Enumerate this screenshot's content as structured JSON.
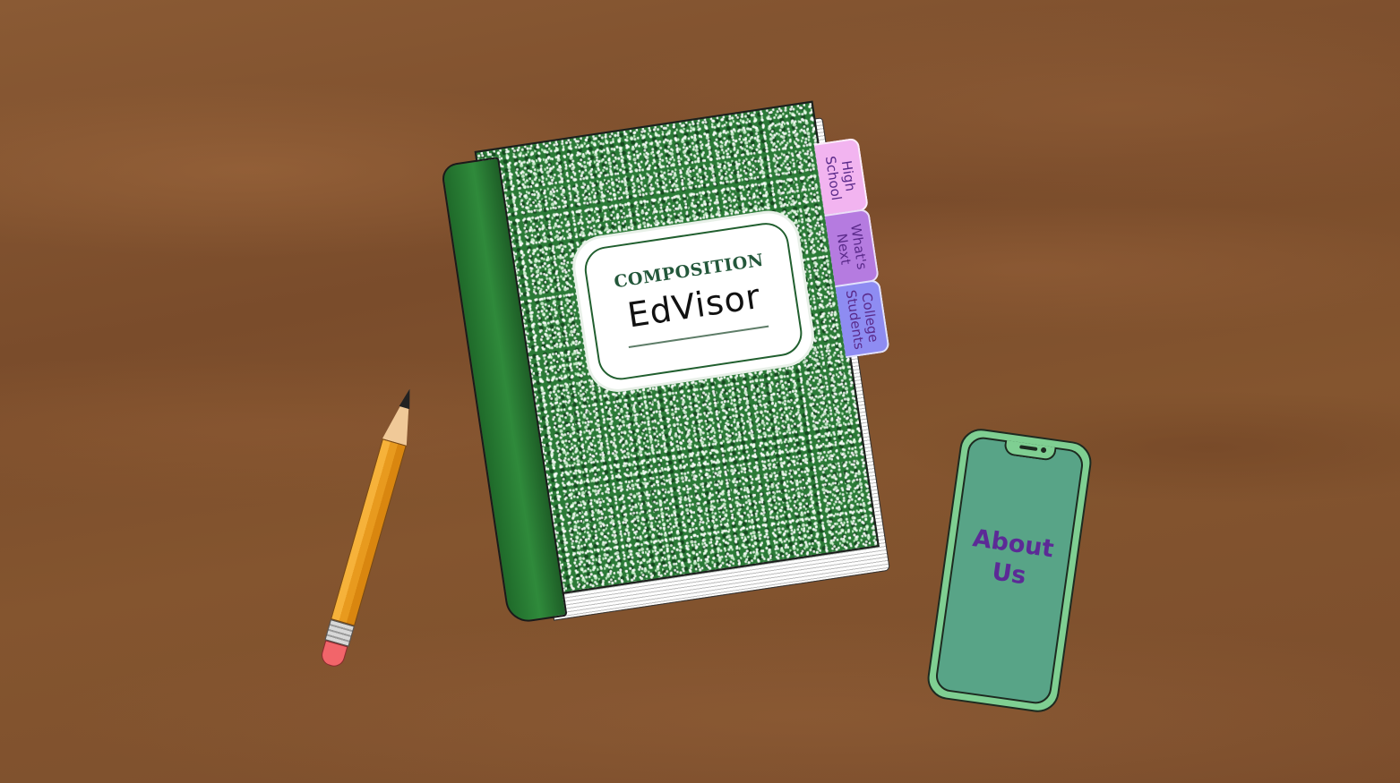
{
  "notebook": {
    "label_heading": "COMPOSITION",
    "title": "EdVisor",
    "tabs": [
      {
        "label": "High\nSchool",
        "color": "#f2b4f0"
      },
      {
        "label": "What's\nNext",
        "color": "#b57be0"
      },
      {
        "label": "College\nStudents",
        "color": "#8e8cf2"
      }
    ],
    "cover_color": "#2b7a37"
  },
  "phone": {
    "label": "About\nUs",
    "color": "#58a487",
    "text_color": "#5c2a96"
  },
  "desk": {
    "color": "#7d4f2c"
  }
}
